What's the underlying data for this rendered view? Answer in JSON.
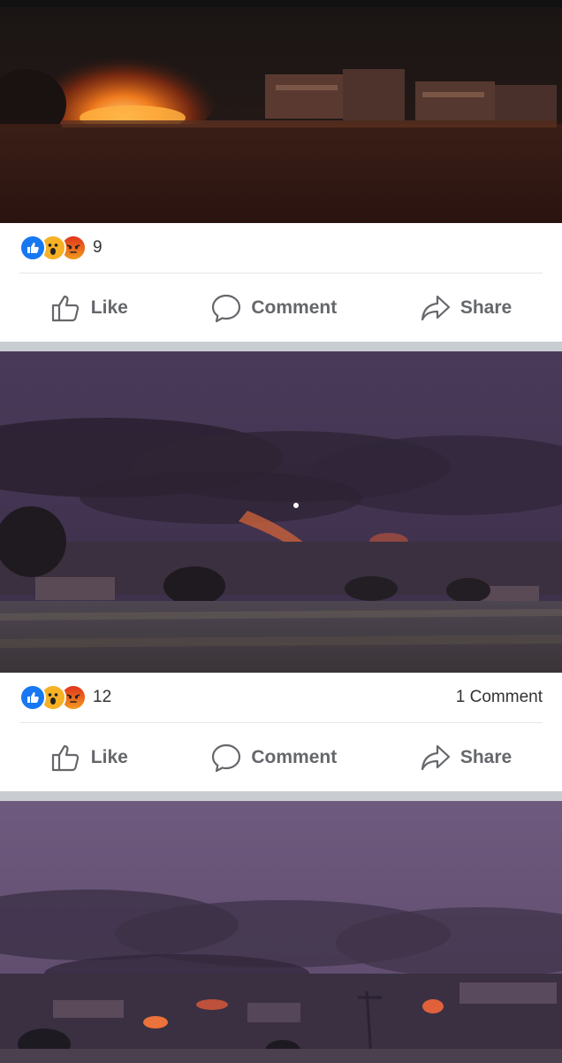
{
  "posts": [
    {
      "reactions": [
        "like",
        "wow",
        "angry"
      ],
      "reaction_count": "9",
      "comment_count": "",
      "actions": {
        "like": "Like",
        "comment": "Comment",
        "share": "Share"
      }
    },
    {
      "reactions": [
        "like",
        "wow",
        "angry"
      ],
      "reaction_count": "12",
      "comment_count": "1 Comment",
      "actions": {
        "like": "Like",
        "comment": "Comment",
        "share": "Share"
      }
    }
  ],
  "colors": {
    "like_blue": "#1877f2",
    "wow_yellow": "#f7b125",
    "angry_orange": "#e9710f",
    "action_gray": "#65676b",
    "feed_background": "#c9ccd1"
  }
}
